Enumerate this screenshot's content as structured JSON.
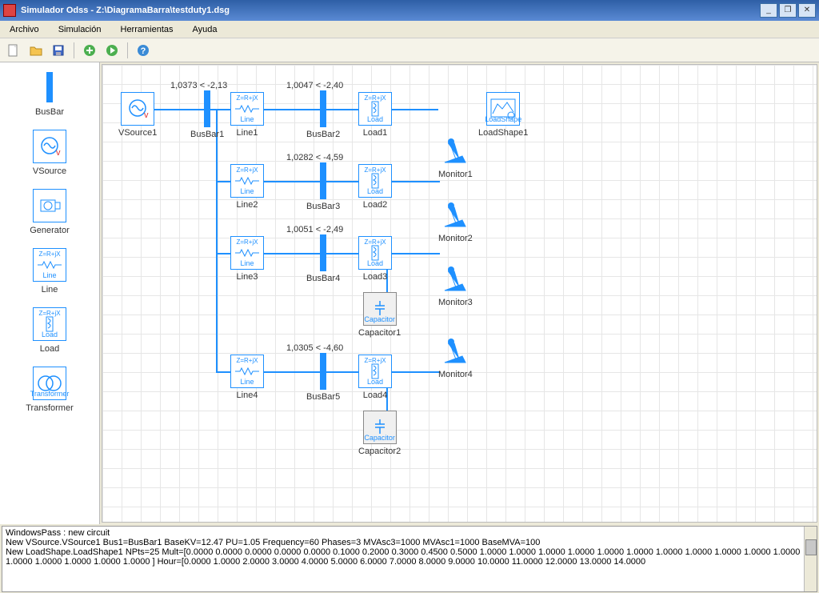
{
  "window": {
    "title": "Simulador Odss - Z:\\DiagramaBarra\\testduty1.dsg"
  },
  "menu": {
    "archivo": "Archivo",
    "simulacion": "Simulación",
    "herramientas": "Herramientas",
    "ayuda": "Ayuda"
  },
  "palette": {
    "busbar": "BusBar",
    "vsource": "VSource",
    "generator": "Generator",
    "line": "Line",
    "load": "Load",
    "transformer": "Transformer"
  },
  "icons": {
    "zformula": "Z=R+jX",
    "line": "Line",
    "load": "Load",
    "generator": "Generator",
    "capacitor": "Capacitor",
    "transformer": "Transformer",
    "loadshape": "LoadShape"
  },
  "canvas": {
    "vsource1": "VSource1",
    "busbar1": "BusBar1",
    "busbar1_val": "1,0373 < -2,13",
    "line1": "Line1",
    "busbar2": "BusBar2",
    "busbar2_val": "1,0047 < -2,40",
    "load1": "Load1",
    "line2": "Line2",
    "busbar3": "BusBar3",
    "busbar3_val": "1,0282 < -4,59",
    "load2": "Load2",
    "line3": "Line3",
    "busbar4": "BusBar4",
    "busbar4_val": "1,0051 < -2,49",
    "load3": "Load3",
    "capacitor1": "Capacitor1",
    "line4": "Line4",
    "busbar5": "BusBar5",
    "busbar5_val": "1,0305 < -4,60",
    "load4": "Load4",
    "capacitor2": "Capacitor2",
    "loadshape1": "LoadShape1",
    "monitor1": "Monitor1",
    "monitor2": "Monitor2",
    "monitor3": "Monitor3",
    "monitor4": "Monitor4"
  },
  "log": {
    "l1": "WindowsPass : new circuit",
    "l2": "New VSource.VSource1 Bus1=BusBar1 BaseKV=12.47 PU=1.05 Frequency=60 Phases=3 MVAsc3=1000 MVAsc1=1000 BaseMVA=100",
    "l3": "New LoadShape.LoadShape1 NPts=25 Mult=[0.0000 0.0000 0.0000 0.0000 0.0000 0.1000 0.2000 0.3000 0.4500 0.5000 1.0000 1.0000 1.0000 1.0000 1.0000 1.0000 1.0000 1.0000 1.0000 1.0000 1.0000",
    "l4": "1.0000 1.0000 1.0000 1.0000 1.0000 ] Hour=[0.0000 1.0000 2.0000 3.0000 4.0000 5.0000 6.0000 7.0000 8.0000 9.0000 10.0000 11.0000 12.0000 13.0000 14.0000"
  }
}
